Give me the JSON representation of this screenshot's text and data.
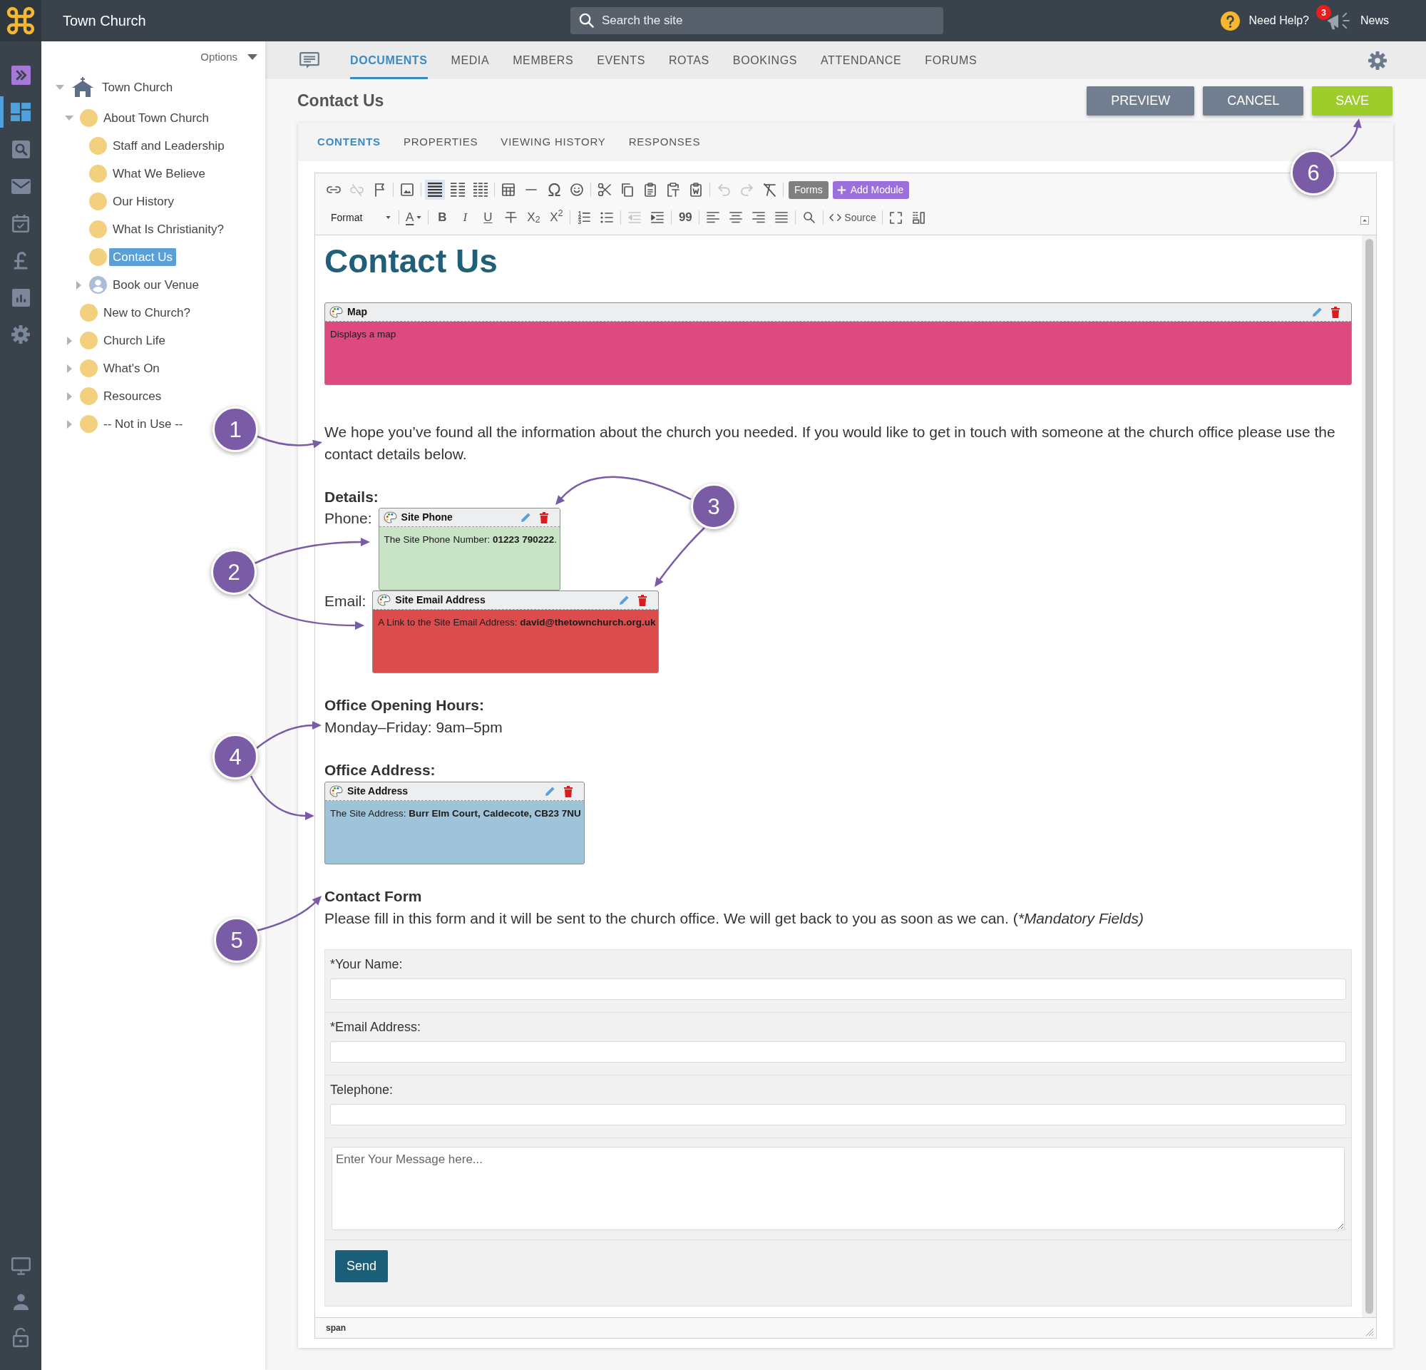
{
  "top_bar": {
    "title": "Town Church",
    "search": {
      "placeholder": "Search the site"
    },
    "help": "Need Help?",
    "news": {
      "badge": "3",
      "label": "News"
    }
  },
  "rail": {
    "top": [
      {
        "kind": "expand",
        "selected": false
      },
      {
        "kind": "dashboard",
        "selected": true
      },
      {
        "kind": "search",
        "selected": false
      },
      {
        "kind": "mail",
        "selected": false
      },
      {
        "kind": "calendar",
        "selected": false
      },
      {
        "kind": "pound",
        "selected": false
      },
      {
        "kind": "chart",
        "selected": false
      },
      {
        "kind": "gear",
        "selected": false
      }
    ],
    "bottom": [
      {
        "kind": "monitor",
        "selected": false
      },
      {
        "kind": "person",
        "selected": false
      },
      {
        "kind": "lock",
        "selected": false
      }
    ]
  },
  "tree": {
    "options": "Options",
    "items": [
      {
        "label": "Town Church",
        "kind": "home",
        "expanded": true,
        "selected": false,
        "children": [
          {
            "label": "About Town Church",
            "kind": "page",
            "expanded": true,
            "selected": false,
            "children": [
              {
                "label": "Staff and Leadership",
                "kind": "page",
                "selected": false
              },
              {
                "label": "What We Believe",
                "kind": "page",
                "selected": false
              },
              {
                "label": "Our History",
                "kind": "page",
                "selected": false
              },
              {
                "label": "What Is Christianity?",
                "kind": "page",
                "selected": false
              },
              {
                "label": "Contact Us",
                "kind": "page",
                "selected": true
              },
              {
                "label": "Book our Venue",
                "kind": "person",
                "expanded": false,
                "selected": false
              }
            ]
          },
          {
            "label": "New to Church?",
            "kind": "page",
            "selected": false
          },
          {
            "label": "Church Life",
            "kind": "page",
            "expanded": false,
            "selected": false
          },
          {
            "label": "What's On",
            "kind": "page",
            "expanded": false,
            "selected": false
          },
          {
            "label": "Resources",
            "kind": "page",
            "expanded": false,
            "selected": false
          },
          {
            "label": "-- Not in Use --",
            "kind": "page",
            "expanded": false,
            "selected": false
          }
        ]
      }
    ]
  },
  "tabs": [
    {
      "label": "DOCUMENTS",
      "selected": true
    },
    {
      "label": "MEDIA",
      "selected": false
    },
    {
      "label": "MEMBERS",
      "selected": false
    },
    {
      "label": "EVENTS",
      "selected": false
    },
    {
      "label": "ROTAS",
      "selected": false
    },
    {
      "label": "BOOKINGS",
      "selected": false
    },
    {
      "label": "ATTENDANCE",
      "selected": false
    },
    {
      "label": "FORUMS",
      "selected": false
    }
  ],
  "page": {
    "title": "Contact Us",
    "buttons": [
      {
        "label": "PREVIEW",
        "kind": "secondary"
      },
      {
        "label": "CANCEL",
        "kind": "secondary"
      },
      {
        "label": "SAVE",
        "kind": "primary"
      }
    ]
  },
  "subtabs": [
    {
      "label": "CONTENTS",
      "selected": true
    },
    {
      "label": "PROPERTIES",
      "selected": false
    },
    {
      "label": "VIEWING HISTORY",
      "selected": false
    },
    {
      "label": "RESPONSES",
      "selected": false
    }
  ],
  "toolbar": {
    "rows": [
      [
        [
          {
            "kind": "link",
            "on": false,
            "disabled": false
          },
          {
            "kind": "unlink",
            "on": false,
            "disabled": true
          },
          {
            "kind": "anchor",
            "on": false,
            "disabled": false
          }
        ],
        [
          {
            "kind": "image",
            "on": false,
            "disabled": false
          }
        ],
        [
          {
            "kind": "block",
            "on": true,
            "disabled": false
          },
          {
            "kind": "columns2",
            "on": false,
            "disabled": false
          },
          {
            "kind": "columns3",
            "on": false,
            "disabled": false
          }
        ],
        [
          {
            "kind": "table",
            "on": false,
            "disabled": false
          },
          {
            "kind": "rule",
            "on": false,
            "disabled": false
          },
          {
            "kind": "omega",
            "on": false,
            "disabled": false
          },
          {
            "kind": "emoji",
            "on": false,
            "disabled": false
          }
        ],
        [
          {
            "kind": "cut",
            "on": false,
            "disabled": false
          },
          {
            "kind": "copy",
            "on": false,
            "disabled": false
          },
          {
            "kind": "paste",
            "on": false,
            "disabled": false
          },
          {
            "kind": "paste_text",
            "on": false,
            "disabled": false
          },
          {
            "kind": "paste_word",
            "on": false,
            "disabled": false
          }
        ],
        [
          {
            "kind": "undo",
            "on": false,
            "disabled": true
          },
          {
            "kind": "redo",
            "on": false,
            "disabled": true
          },
          {
            "kind": "clear",
            "on": false,
            "disabled": false
          }
        ],
        [
          {
            "kind": "forms",
            "label": "Forms",
            "on": false,
            "disabled": false
          },
          {
            "kind": "add",
            "label": "Add Module",
            "on": false,
            "disabled": false
          }
        ]
      ],
      [
        [
          {
            "kind": "format",
            "label": "Format",
            "on": false,
            "disabled": false
          }
        ],
        [
          {
            "kind": "color",
            "label": "A",
            "on": false,
            "disabled": false
          }
        ],
        [
          {
            "kind": "bold",
            "label": "B",
            "on": false,
            "disabled": false
          },
          {
            "kind": "italic",
            "label": "I",
            "on": false,
            "disabled": false
          },
          {
            "kind": "underline",
            "label": "U",
            "on": false,
            "disabled": false
          },
          {
            "kind": "strike",
            "on": false,
            "disabled": false
          },
          {
            "kind": "subscript",
            "label": "X$_{2}$",
            "on": false,
            "disabled": false
          },
          {
            "kind": "superscript",
            "label": "X$^{2}$",
            "on": false,
            "disabled": false
          }
        ],
        [
          {
            "kind": "ordered",
            "on": false,
            "disabled": false
          },
          {
            "kind": "bulleted",
            "on": false,
            "disabled": false
          }
        ],
        [
          {
            "kind": "outdent",
            "on": false,
            "disabled": true
          },
          {
            "kind": "indent",
            "on": false,
            "disabled": false
          }
        ],
        [
          {
            "kind": "quote",
            "label": "99",
            "on": false,
            "disabled": false
          }
        ],
        [
          {
            "kind": "left",
            "on": false,
            "disabled": false
          },
          {
            "kind": "center",
            "on": false,
            "disabled": false
          },
          {
            "kind": "right",
            "on": false,
            "disabled": false
          },
          {
            "kind": "justify",
            "on": false,
            "disabled": false
          }
        ],
        [
          {
            "kind": "find",
            "on": false,
            "disabled": false
          }
        ],
        [
          {
            "kind": "source",
            "label": "Source",
            "on": false,
            "disabled": false
          }
        ],
        [
          {
            "kind": "maximize",
            "on": false,
            "disabled": false
          },
          {
            "kind": "blocks",
            "on": false,
            "disabled": false
          }
        ]
      ]
    ]
  },
  "content": [
    {
      "kind": "heading",
      "text": "Contact Us"
    },
    {
      "kind": "map",
      "title": "Map",
      "body": "Displays a map",
      "color": "#dc4a7f"
    },
    {
      "kind": "paragraph",
      "text": "We hope you’ve found all the information about the church you needed. If you would like to get in touch with someone at the church office please use the contact details below."
    },
    {
      "kind": "label",
      "text": "Details:"
    },
    {
      "kind": "field",
      "label": "Phone:",
      "module": {
        "title": "Site Phone",
        "body": "The Site Phone Number: **01223 790222**.",
        "color": "#c9e3c7"
      }
    },
    {
      "kind": "field",
      "label": "Email:",
      "module": {
        "title": "Site Email Address",
        "body": "A Link to the Site Email Address: **david@thetownchurch.org.uk**",
        "color": "#dd4c4c"
      }
    },
    {
      "kind": "label",
      "text": "Office Opening Hours:"
    },
    {
      "kind": "paragraph",
      "text": "Monday–Friday: 9am–5pm"
    },
    {
      "kind": "label",
      "text": "Office Address:"
    },
    {
      "kind": "module",
      "title": "Site Address",
      "body": "The Site Address: **Burr Elm Court, Caldecote, CB23 7NU**",
      "color": "#9fc4da"
    },
    {
      "kind": "label",
      "text": "Contact Form"
    },
    {
      "kind": "paragraph",
      "parts": [
        {
          "text": "Please fill in this form and it will be sent to the church office. We will get back to you as soon as we can. (",
          "italic": false
        },
        {
          "text": "*Mandatory Fields)",
          "italic": true
        }
      ]
    }
  ],
  "form": {
    "fields": [
      {
        "kind": "input",
        "label": "*Your Name:"
      },
      {
        "kind": "input",
        "label": "*Email Address:"
      },
      {
        "kind": "input",
        "label": "Telephone:"
      },
      {
        "kind": "textarea",
        "placeholder": "Enter Your Message here..."
      }
    ],
    "submit": "Send"
  },
  "status_bar": {
    "path": "span"
  },
  "annotations": [
    {
      "number": "1"
    },
    {
      "number": "2"
    },
    {
      "number": "3"
    },
    {
      "number": "4"
    },
    {
      "number": "5"
    },
    {
      "number": "6"
    }
  ]
}
